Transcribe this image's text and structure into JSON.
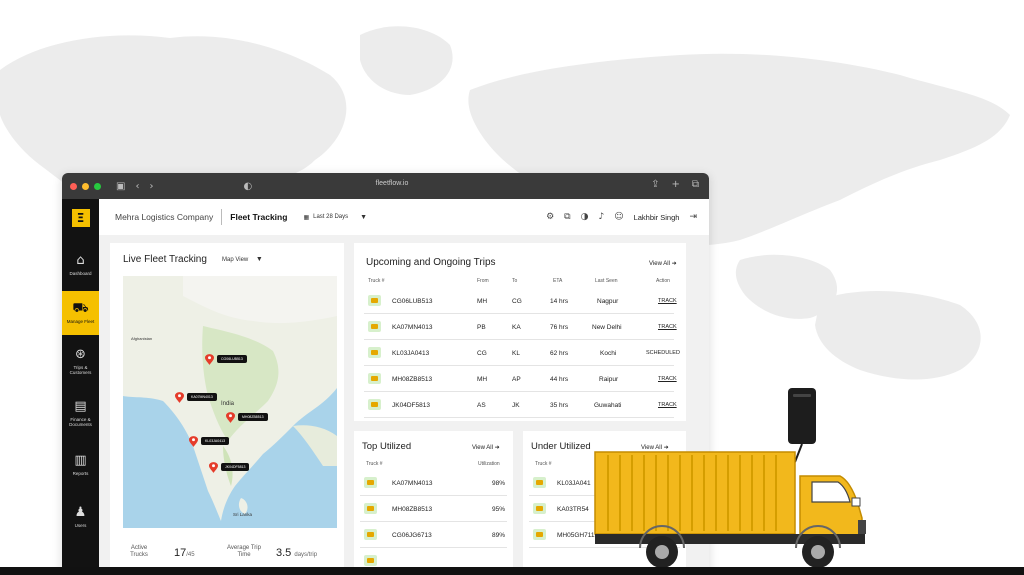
{
  "browser": {
    "url": "fleetflow.io",
    "dots": [
      "#ff5f56",
      "#ffbd2e",
      "#27c93f"
    ]
  },
  "sidebar": {
    "logo_icon": "logo-mark",
    "items": [
      {
        "label": "Dashboard",
        "icon": "home-icon",
        "active": false
      },
      {
        "label": "Manage Fleet",
        "icon": "truck-icon",
        "active": true
      },
      {
        "label": "Trips & Customers",
        "icon": "route-icon",
        "active": false
      },
      {
        "label": "Finance & Documents",
        "icon": "document-icon",
        "active": false
      },
      {
        "label": "Reports",
        "icon": "chart-icon",
        "active": false
      },
      {
        "label": "Users",
        "icon": "users-icon",
        "active": false
      }
    ]
  },
  "header": {
    "company": "Mehra Logistics Company",
    "product": "Fleet Tracking",
    "range": "Last 28 Days",
    "user": "Lakhbir Singh"
  },
  "fleet": {
    "title": "Live Fleet Tracking",
    "map_view": "Map View",
    "map_labels": [
      "India",
      "Sri Lanka",
      "Afghanistan"
    ],
    "pins": [
      {
        "label": "CG06LUB513"
      },
      {
        "label": "KA07MN4013"
      },
      {
        "label": "MH08ZB8513"
      },
      {
        "label": "KL03JA0413"
      },
      {
        "label": "JK04DF5813"
      }
    ],
    "stats": {
      "active_label": "Active Trucks",
      "active_value": "17",
      "active_total": "/45",
      "trip_label": "Average Trip Time",
      "trip_value": "3.5",
      "trip_unit": "days/trip"
    }
  },
  "trips": {
    "title": "Upcoming and Ongoing Trips",
    "view_all": "View All",
    "columns": [
      "Truck #",
      "From",
      "To",
      "ETA",
      "Last Seen",
      "Action"
    ],
    "rows": [
      {
        "truck": "CG06LUB513",
        "from": "MH",
        "to": "CG",
        "eta": "14 hrs",
        "last_seen": "Nagpur",
        "action": "TRACK"
      },
      {
        "truck": "KA07MN4013",
        "from": "PB",
        "to": "KA",
        "eta": "76 hrs",
        "last_seen": "New Delhi",
        "action": "TRACK"
      },
      {
        "truck": "KL03JA0413",
        "from": "CG",
        "to": "KL",
        "eta": "62 hrs",
        "last_seen": "Kochi",
        "action": "SCHEDULED"
      },
      {
        "truck": "MH08ZB8513",
        "from": "MH",
        "to": "AP",
        "eta": "44 hrs",
        "last_seen": "Raipur",
        "action": "TRACK"
      },
      {
        "truck": "JK04DF5813",
        "from": "AS",
        "to": "JK",
        "eta": "35 hrs",
        "last_seen": "Guwahati",
        "action": "TRACK"
      }
    ]
  },
  "top_utilized": {
    "title": "Top Utilized",
    "view_all": "View All",
    "col_truck": "Truck #",
    "col_util": "Utilization",
    "rows": [
      {
        "truck": "KA07MN4013",
        "value": "98%"
      },
      {
        "truck": "MH08ZB8513",
        "value": "95%"
      },
      {
        "truck": "CG06JG6713",
        "value": "89%"
      }
    ]
  },
  "under_utilized": {
    "title": "Under Utilized",
    "view_all": "View All",
    "col_truck": "Truck #",
    "rows": [
      {
        "truck": "KL03JA041"
      },
      {
        "truck": "KA03TR54"
      },
      {
        "truck": "MH05GH7113"
      }
    ]
  },
  "colors": {
    "accent": "#f5c000",
    "sidebar_bg": "#121212",
    "truck_body": "#f2b81c",
    "row_badge": "#d7f0cc"
  }
}
